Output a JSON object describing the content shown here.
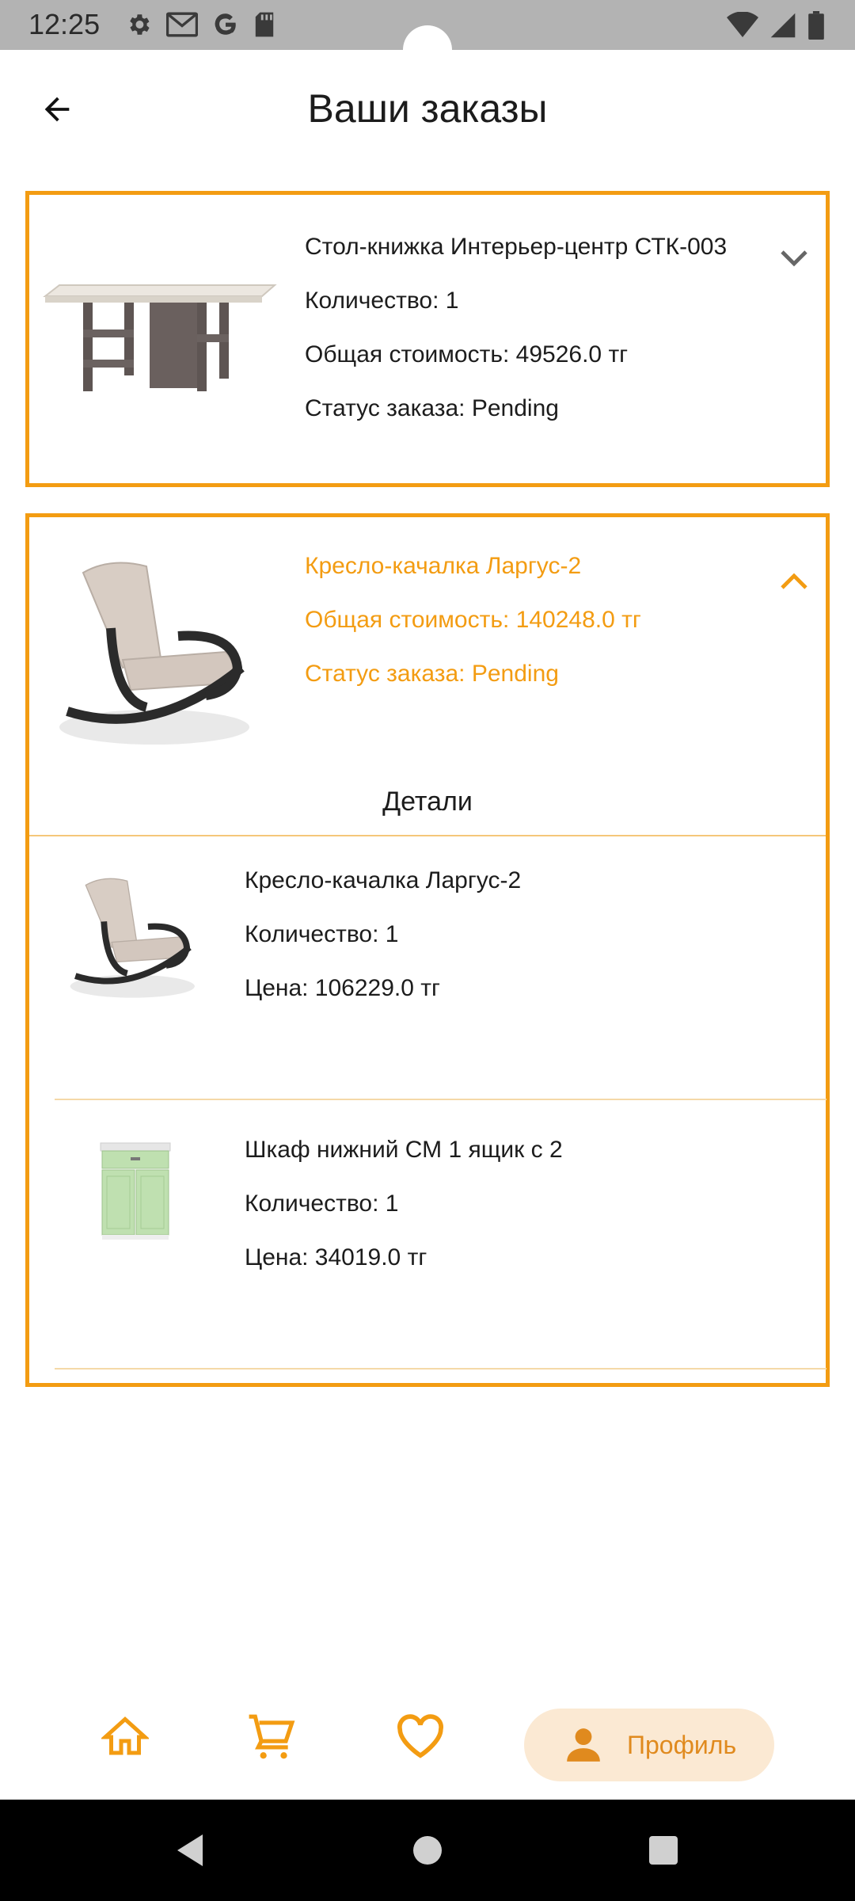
{
  "status_bar": {
    "time": "12:25",
    "left_icons": [
      "gear-icon",
      "gmail-icon",
      "google-icon",
      "sd-card-icon"
    ],
    "right_icons": [
      "wifi-icon",
      "signal-icon",
      "battery-icon"
    ]
  },
  "header": {
    "title": "Ваши заказы",
    "back_icon": "arrow-left-icon"
  },
  "orders": [
    {
      "name": "Стол-книжка Интерьер-центр СТК-003",
      "quantity": "Количество: 1",
      "total": "Общая стоимость: 49526.0 тг",
      "status": "Статус заказа: Pending",
      "expanded": false,
      "expand_icon": "chevron-down-icon"
    },
    {
      "name": " Кресло-качалка Ларгус-2",
      "total": "Общая стоимость: 140248.0 тг",
      "status": "Статус заказа: Pending",
      "expanded": true,
      "expand_icon": "chevron-up-icon",
      "details_title": "Детали",
      "items": [
        {
          "name": " Кресло-качалка Ларгус-2",
          "quantity": "Количество: 1",
          "price": "Цена: 106229.0 тг"
        },
        {
          "name": " Шкаф нижний СМ 1 ящик с 2",
          "quantity": "Количество: 1",
          "price": "Цена: 34019.0 тг"
        }
      ]
    }
  ],
  "bottom_nav": {
    "items": [
      {
        "icon": "home-icon"
      },
      {
        "icon": "cart-icon"
      },
      {
        "icon": "heart-icon"
      },
      {
        "icon": "person-icon",
        "label": "Профиль",
        "active": true
      }
    ]
  },
  "colors": {
    "accent": "#f39c12",
    "accent_light": "#fbe9d3",
    "nav_icon": "#e08a1e"
  }
}
